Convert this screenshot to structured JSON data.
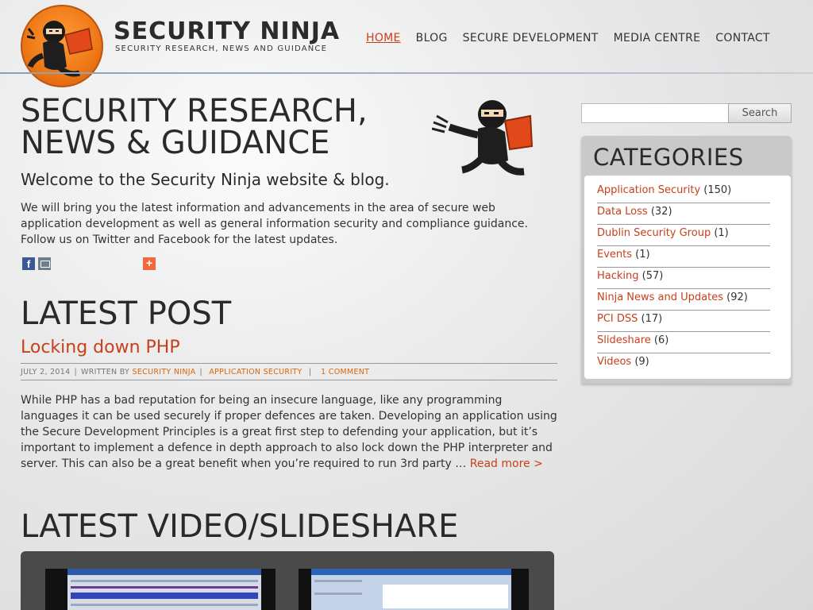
{
  "brand": {
    "title": "SECURITY NINJA",
    "tagline": "SECURITY RESEARCH, NEWS AND GUIDANCE",
    "accent": "#c8401b"
  },
  "nav": {
    "items": [
      {
        "label": "HOME",
        "active": true
      },
      {
        "label": "BLOG",
        "active": false
      },
      {
        "label": "SECURE DEVELOPMENT",
        "active": false
      },
      {
        "label": "MEDIA CENTRE",
        "active": false
      },
      {
        "label": "CONTACT",
        "active": false
      }
    ]
  },
  "hero": {
    "title": "SECURITY RESEARCH, NEWS & GUIDANCE",
    "welcome": "Welcome to the Security Ninja website & blog.",
    "intro": "We will bring you the latest information and advancements in the area of secure web application development as well as general information security and compliance guidance. Follow us on Twitter and Facebook for the latest updates."
  },
  "share": {
    "icons": [
      "facebook-icon",
      "email-icon",
      "add-share-icon"
    ]
  },
  "latest_post": {
    "heading": "LATEST POST",
    "title": "Locking down PHP",
    "date": "JULY 2, 2014",
    "written_by": "WRITTEN BY",
    "author": "SECURITY NINJA",
    "category": "APPLICATION SECURITY",
    "comments": "1 COMMENT",
    "excerpt": "While PHP has a bad reputation for being an insecure language, like any programming languages it can be used securely if proper defences are taken. Developing an application using the Secure Development Principles is a great first step to defending your application, but it’s important to implement a defence in depth approach to also lock down the PHP interpreter and server. This can also be a great benefit when you’re required to run 3rd party …",
    "read_more": "Read more >"
  },
  "videos": {
    "heading": "LATEST VIDEO/SLIDESHARE"
  },
  "search": {
    "placeholder": "",
    "button": "Search"
  },
  "categories": {
    "title": "CATEGORIES",
    "items": [
      {
        "name": "Application Security",
        "count": "(150)"
      },
      {
        "name": "Data Loss",
        "count": "(32)"
      },
      {
        "name": "Dublin Security Group",
        "count": "(1)"
      },
      {
        "name": "Events",
        "count": "(1)"
      },
      {
        "name": "Hacking",
        "count": "(57)"
      },
      {
        "name": "Ninja News and Updates",
        "count": "(92)"
      },
      {
        "name": "PCI DSS",
        "count": "(17)"
      },
      {
        "name": "Slideshare",
        "count": "(6)"
      },
      {
        "name": "Videos",
        "count": "(9)"
      }
    ]
  }
}
